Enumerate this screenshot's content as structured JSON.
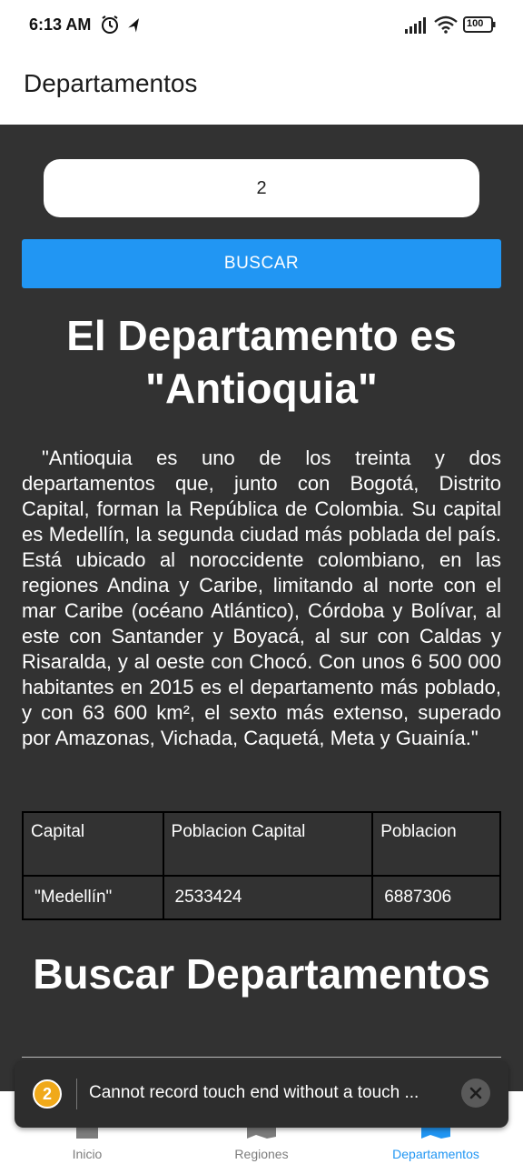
{
  "status_bar": {
    "time": "6:13 AM",
    "battery": "100",
    "icons": [
      "alarm-icon",
      "navigation-icon",
      "signal-icon",
      "wifi-icon",
      "battery-icon"
    ]
  },
  "app_bar": {
    "title": "Departamentos"
  },
  "search": {
    "value": "2",
    "button_label": "BUSCAR"
  },
  "result": {
    "title": "El Departamento es \"Antioquia\"",
    "description": "\"Antioquia es uno de los treinta y dos departamentos que, junto con Bogotá, Distrito Capital, forman la República de Colombia. Su capital es Medellín, la segunda ciudad más poblada del país. Está ubicado al noroccidente colombiano, en las regiones Andina y Caribe, limitando al norte con el mar Caribe (océano Atlántico), Córdoba y Bolívar, al este con Santander y Boyacá, al sur con Caldas y Risaralda, y al oeste con Chocó. Con unos 6 500 000 habitantes en 2015 es el departamento más poblado, y con 63 600 km², el sexto más extenso, superado por Amazonas, Vichada, Caquetá, Meta y Guainía.\""
  },
  "table": {
    "headers": [
      "Capital",
      "Poblacion Capital",
      "Poblacion"
    ],
    "rows": [
      [
        "\"Medellín\"",
        "2533424",
        "6887306"
      ]
    ]
  },
  "section_title": "Buscar Departamentos",
  "toast": {
    "badge": "2",
    "message": "Cannot record touch end without a touch ..."
  },
  "bottom_nav": {
    "items": [
      {
        "label": "Inicio",
        "icon": "home-icon"
      },
      {
        "label": "Regiones",
        "icon": "map-icon"
      },
      {
        "label": "Departamentos",
        "icon": "map-icon",
        "active": true
      }
    ],
    "active_color": "#2196f3"
  },
  "colors": {
    "content_bg": "#323232",
    "button": "#2196f3",
    "toast_badge": "#f0a91a"
  }
}
